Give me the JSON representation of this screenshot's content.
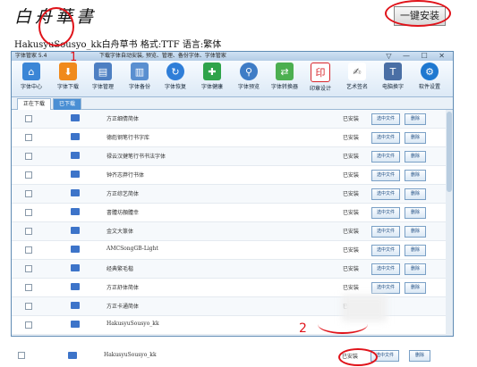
{
  "header": {
    "title": "白舟華書",
    "install_button": "一键安装",
    "meta": "HakusyuSousyo_kk白舟草书 格式:TTF 语言:繁体"
  },
  "app": {
    "version": "字体管家 5.4",
    "subtitle": "下载字体自动安装, 预览、管理、备份字体、字体管家",
    "window_controls": "▽ — ☐ ✕",
    "toolbar": [
      {
        "label": "字体中心",
        "icon": "home-icon",
        "color": "#3b86d6"
      },
      {
        "label": "字体下载",
        "icon": "download-icon",
        "color": "#f08a1c"
      },
      {
        "label": "字体管理",
        "icon": "manage-icon",
        "color": "#4d7fc2"
      },
      {
        "label": "字体备份",
        "icon": "backup-icon",
        "color": "#5a8fd0"
      },
      {
        "label": "字体恢复",
        "icon": "restore-icon",
        "color": "#2f7ed8"
      },
      {
        "label": "字体健康",
        "icon": "health-cross-icon",
        "color": "#2fa34a"
      },
      {
        "label": "字体预览",
        "icon": "magnifier-icon",
        "color": "#3e7cc6"
      },
      {
        "label": "字体转换器",
        "icon": "convert-icon",
        "color": "#4caf50"
      },
      {
        "label": "印章设计",
        "icon": "seal-icon",
        "color": "#d8262b"
      },
      {
        "label": "艺术签名",
        "icon": "signature-icon",
        "color": "#888888"
      },
      {
        "label": "电脑换字",
        "icon": "computer-font-icon",
        "color": "#4a6fa5"
      },
      {
        "label": "软件设置",
        "icon": "gear-icon",
        "color": "#1e78d0"
      }
    ],
    "tabs": [
      {
        "label": "正在下载"
      },
      {
        "label": "已下载"
      }
    ],
    "rows": [
      {
        "name": "方正细倩简体",
        "status": "已安装",
        "select": "选中文件",
        "delete": "删除"
      },
      {
        "name": "德彪钢笔行书字库",
        "status": "已安装",
        "select": "选中文件",
        "delete": "删除"
      },
      {
        "name": "禄云汉健笔行书书法字体",
        "status": "已安装",
        "select": "选中文件",
        "delete": "删除"
      },
      {
        "name": "钟齐志莽行书体",
        "status": "已安装",
        "select": "选中文件",
        "delete": "删除"
      },
      {
        "name": "方正综艺简体",
        "status": "已安装",
        "select": "选中文件",
        "delete": "删除"
      },
      {
        "name": "書體坊顏體幸",
        "status": "已安装",
        "select": "选中文件",
        "delete": "删除"
      },
      {
        "name": "金文大篆体",
        "status": "已安装",
        "select": "选中文件",
        "delete": "删除"
      },
      {
        "name": "AMCSongGB-Light",
        "status": "已安装",
        "select": "选中文件",
        "delete": "删除"
      },
      {
        "name": "经典繁毛楷",
        "status": "已安装",
        "select": "选中文件",
        "delete": "删除"
      },
      {
        "name": "方正舒体简体",
        "status": "已安装",
        "select": "选中文件",
        "delete": "删除"
      },
      {
        "name": "方正卡通简体",
        "status": "已安",
        "select": "",
        "delete": ""
      },
      {
        "name": "HakusyuSousyo_kk",
        "status": "",
        "select": "",
        "delete": ""
      }
    ],
    "bottom_row": {
      "name": "HakusyuSousyo_kk",
      "status": "已安装",
      "select": "选中文件",
      "delete": "删除"
    }
  },
  "annotations": {
    "one": "1",
    "two": "2"
  },
  "colors": {
    "accent_red": "#e0131a",
    "toolbar_blue": "#4a8fd4"
  }
}
